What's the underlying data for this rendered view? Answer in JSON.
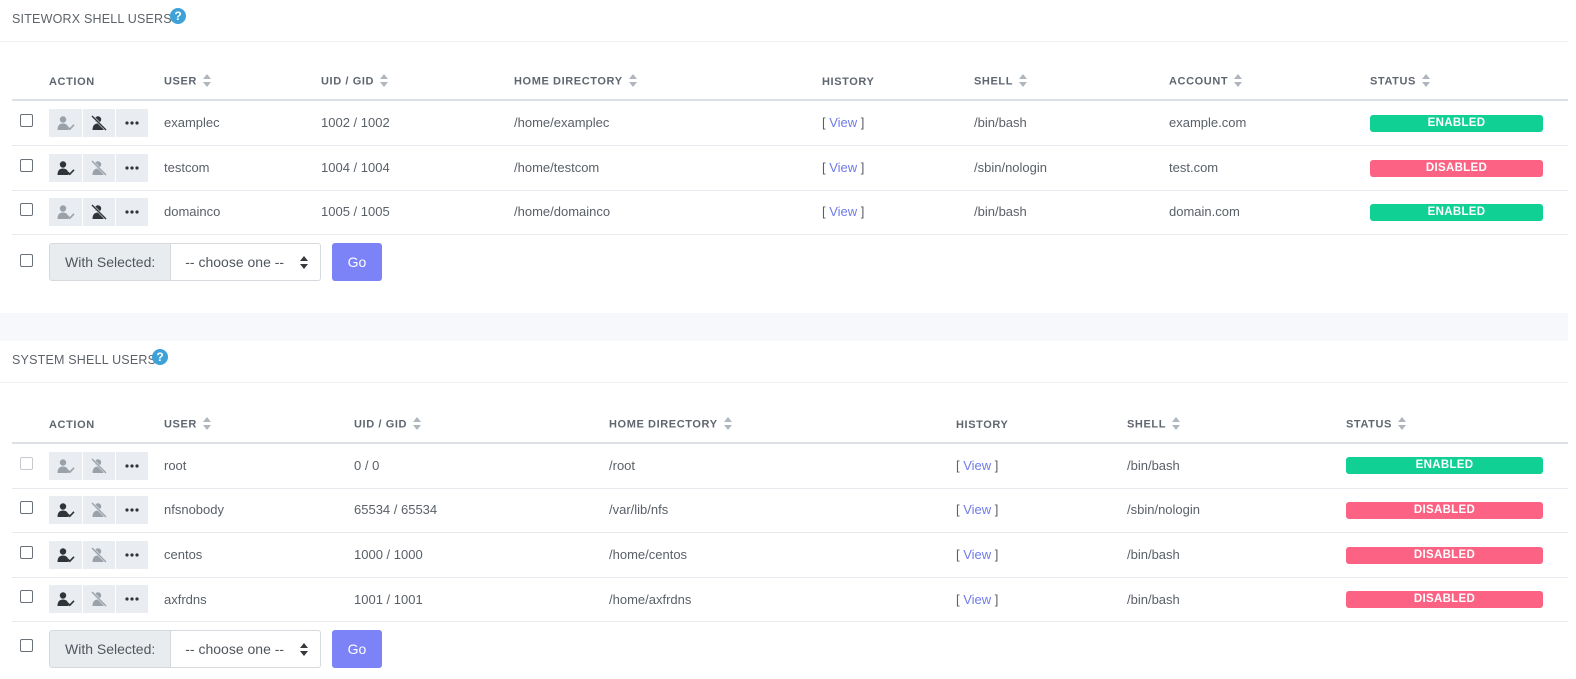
{
  "siteworx": {
    "title": "SITEWORX SHELL USERS",
    "help": "?",
    "headers": {
      "action": "ACTION",
      "user": "USER",
      "uid_gid": "UID / GID",
      "home": "HOME DIRECTORY",
      "history": "HISTORY",
      "shell": "SHELL",
      "account": "ACCOUNT",
      "status": "STATUS"
    },
    "rows": [
      {
        "user": "examplec",
        "uid_gid": "1002 / 1002",
        "home": "/home/examplec",
        "history_open": "[ ",
        "history_link": "View",
        "history_close": " ]",
        "shell": "/bin/bash",
        "account": "example.com",
        "status": "ENABLED"
      },
      {
        "user": "testcom",
        "uid_gid": "1004 / 1004",
        "home": "/home/testcom",
        "history_open": "[ ",
        "history_link": "View",
        "history_close": " ]",
        "shell": "/sbin/nologin",
        "account": "test.com",
        "status": "DISABLED"
      },
      {
        "user": "domainco",
        "uid_gid": "1005 / 1005",
        "home": "/home/domainco",
        "history_open": "[ ",
        "history_link": "View",
        "history_close": " ]",
        "shell": "/bin/bash",
        "account": "domain.com",
        "status": "ENABLED"
      }
    ],
    "bulk": {
      "label": "With Selected:",
      "select_value": "-- choose one --",
      "go": "Go"
    }
  },
  "system": {
    "title": "SYSTEM SHELL USERS",
    "help": "?",
    "headers": {
      "action": "ACTION",
      "user": "USER",
      "uid_gid": "UID / GID",
      "home": "HOME DIRECTORY",
      "history": "HISTORY",
      "shell": "SHELL",
      "status": "STATUS"
    },
    "rows": [
      {
        "user": "root",
        "uid_gid": "0 / 0",
        "home": "/root",
        "history_open": "[ ",
        "history_link": "View",
        "history_close": " ]",
        "shell": "/bin/bash",
        "status": "ENABLED"
      },
      {
        "user": "nfsnobody",
        "uid_gid": "65534 / 65534",
        "home": "/var/lib/nfs",
        "history_open": "[ ",
        "history_link": "View",
        "history_close": " ]",
        "shell": "/sbin/nologin",
        "status": "DISABLED"
      },
      {
        "user": "centos",
        "uid_gid": "1000 / 1000",
        "home": "/home/centos",
        "history_open": "[ ",
        "history_link": "View",
        "history_close": " ]",
        "shell": "/bin/bash",
        "status": "DISABLED"
      },
      {
        "user": "axfrdns",
        "uid_gid": "1001 / 1001",
        "home": "/home/axfrdns",
        "history_open": "[ ",
        "history_link": "View",
        "history_close": " ]",
        "shell": "/bin/bash",
        "status": "DISABLED"
      }
    ],
    "bulk": {
      "label": "With Selected:",
      "select_value": "-- choose one --",
      "go": "Go"
    }
  },
  "icons": {
    "enable": "user-check-icon",
    "disable": "user-slash-icon",
    "more": "more-icon"
  },
  "colors": {
    "enabled": "#10d094",
    "disabled": "#fb6283",
    "link": "#6f7be8",
    "go_button": "#7b83f7",
    "help": "#3ea2d9"
  }
}
